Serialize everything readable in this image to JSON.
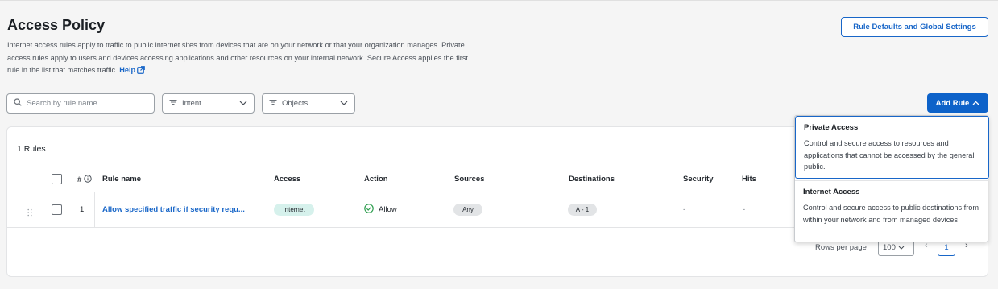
{
  "page": {
    "title": "Access Policy",
    "description": "Internet access rules apply to traffic to public internet sites from devices that are on your network or that your organization manages. Private access rules apply to users and devices accessing applications and other resources on your internal network. Secure Access applies the first rule in the list that matches traffic.",
    "help_label": "Help",
    "defaults_button": "Rule Defaults and Global Settings"
  },
  "toolbar": {
    "search_placeholder": "Search by rule name",
    "intent_label": "Intent",
    "objects_label": "Objects",
    "add_rule_label": "Add Rule"
  },
  "table": {
    "count_label": "1 Rules",
    "headers": {
      "num": "#",
      "name": "Rule name",
      "access": "Access",
      "action": "Action",
      "sources": "Sources",
      "destinations": "Destinations",
      "security": "Security",
      "hits": "Hits"
    },
    "rows": [
      {
        "num": "1",
        "name": "Allow specified traffic if security requ...",
        "access": "Internet",
        "action": "Allow",
        "sources": "Any",
        "destinations": "A - 1",
        "security": "-",
        "hits": "-"
      }
    ]
  },
  "pagination": {
    "rows_per_page_label": "Rows per page",
    "rows_per_page_value": "100",
    "current_page": "1"
  },
  "add_rule_menu": [
    {
      "title": "Private Access",
      "description": "Control and secure access to resources and applications that cannot be accessed by the general public."
    },
    {
      "title": "Internet Access",
      "description": "Control and secure access to public destinations from within your network and from managed devices"
    }
  ],
  "colors": {
    "accent": "#1866c8",
    "primary_button": "#0d62c9",
    "internet_pill": "#d6f1ec",
    "allow_icon": "#2e9e4f"
  }
}
